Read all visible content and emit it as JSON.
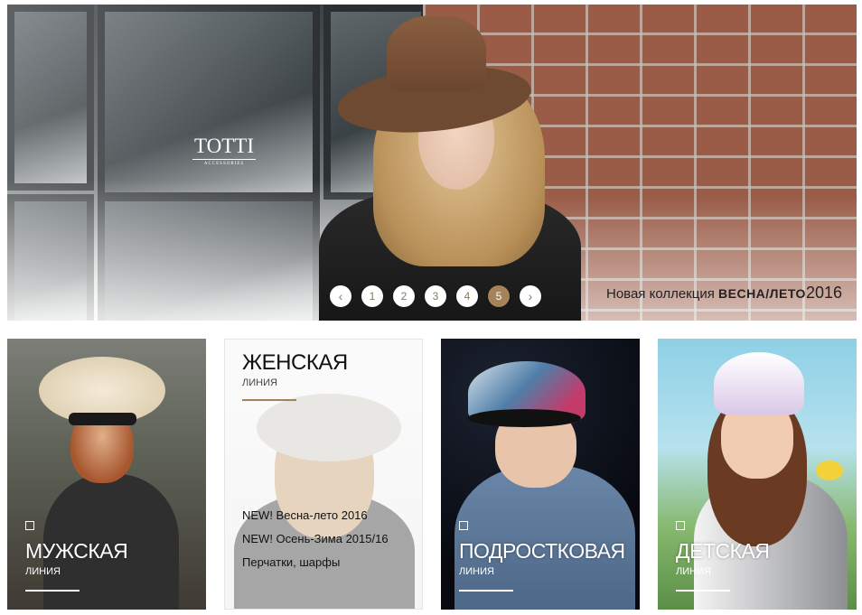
{
  "hero": {
    "logo": {
      "brand": "TOTTI",
      "sub": "ACCESSORIES"
    },
    "pager": {
      "prev": "‹",
      "pages": [
        "1",
        "2",
        "3",
        "4",
        "5"
      ],
      "active_page": "5",
      "next": "›"
    },
    "tagline": {
      "prefix": "Новая коллекция",
      "season": "ВЕСНА/ЛЕТО",
      "year": "2016"
    }
  },
  "cards": {
    "men": {
      "title": "МУЖСКАЯ",
      "line": "ЛИНИЯ"
    },
    "women": {
      "title": "ЖЕНСКАЯ",
      "line": "ЛИНИЯ",
      "links": [
        "NEW! Весна-лето 2016",
        "NEW! Осень-Зима 2015/16",
        "Перчатки, шарфы"
      ]
    },
    "teen": {
      "title": "ПОДРОСТКОВАЯ",
      "line": "ЛИНИЯ"
    },
    "kids": {
      "title": "ДЕТСКАЯ",
      "line": "ЛИНИЯ"
    }
  },
  "colors": {
    "accent": "#a2835a",
    "text": "#222222",
    "white": "#ffffff"
  },
  "icons": {
    "prev": "chevron-left-icon",
    "next": "chevron-right-icon",
    "marker": "square-outline-icon"
  }
}
